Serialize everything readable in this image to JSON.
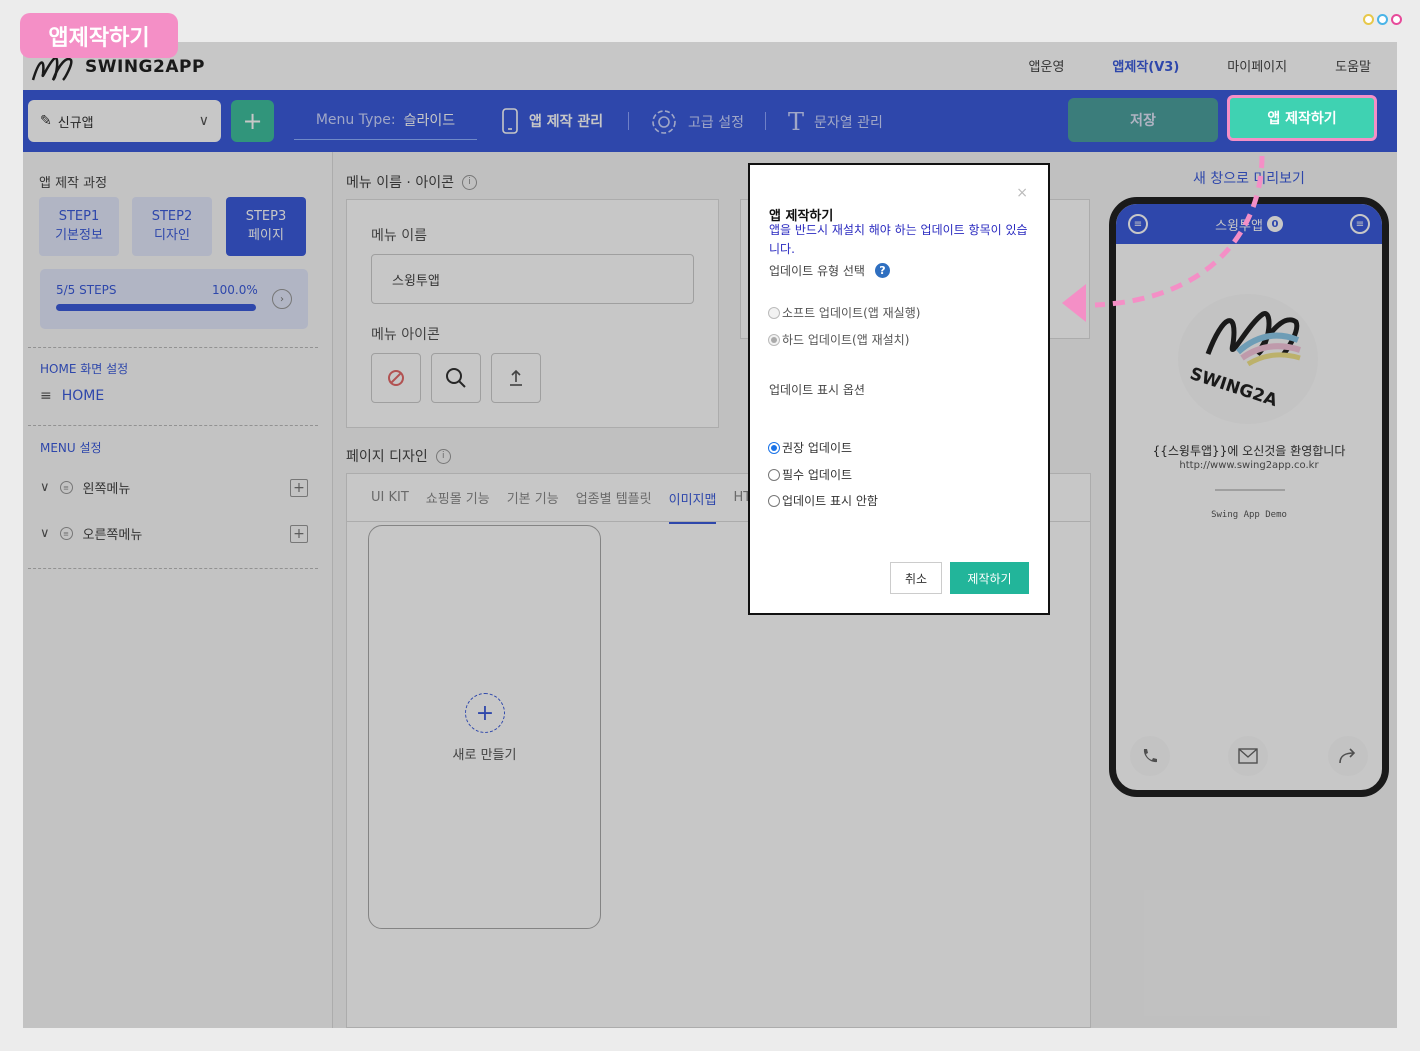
{
  "label_badge": "앱제작하기",
  "header": {
    "logo_text": "SWING2APP",
    "nav": [
      "앱운영",
      "앱제작(V3)",
      "마이페이지",
      "도움말"
    ]
  },
  "toolbar": {
    "app_select": "신규앱",
    "add_label": "+",
    "menu_type_label": "Menu Type:",
    "menu_type_value": "슬라이드",
    "app_manage": "앱 제작 관리",
    "advanced": "고급 설정",
    "strings": "문자열 관리",
    "save": "저장",
    "build": "앱 제작하기"
  },
  "sidebar": {
    "title": "앱 제작 과정",
    "steps": [
      {
        "line1": "STEP1",
        "line2": "기본정보"
      },
      {
        "line1": "STEP2",
        "line2": "디자인"
      },
      {
        "line1": "STEP3",
        "line2": "페이지"
      }
    ],
    "progress_label": "5/5 STEPS",
    "progress_pct": "100.0%",
    "progress_value": 1.0,
    "home_section": "HOME 화면 설정",
    "home_item": "HOME",
    "menu_section": "MENU 설정",
    "menus": [
      "왼쪽메뉴",
      "오른쪽메뉴"
    ]
  },
  "main": {
    "name_icon_title": "메뉴 이름 · 아이콘",
    "name_label": "메뉴 이름",
    "name_value": "스윙투앱",
    "icon_label": "메뉴 아이콘",
    "page_design_title": "페이지 디자인",
    "tabs": [
      "UI KIT",
      "쇼핑몰 기능",
      "기본 기능",
      "업종별 템플릿",
      "이미지맵",
      "HT"
    ],
    "new_label": "새로 만들기"
  },
  "preview": {
    "link": "새 창으로 미리보기",
    "app_name": "스윙투앱",
    "badge": "0",
    "welcome": "{{스윙투앱}}에 오신것을 환영합니다",
    "url": "http://www.swing2app.co.kr",
    "demo": "Swing App Demo",
    "logo_text": "SWING2A"
  },
  "modal": {
    "close": "×",
    "title": "앱 제작하기",
    "warning": "앱을 반드시 재설치 해야 하는 업데이트 항목이 있습니다.",
    "update_type_label": "업데이트 유형 선택",
    "options_type": [
      "소프트 업데이트(앱 재실행)",
      "하드 업데이트(앱 재설치)"
    ],
    "display_label": "업데이트 표시 옵션",
    "options_display": [
      "권장 업데이트",
      "필수 업데이트",
      "업데이트 표시 안함"
    ],
    "cancel": "취소",
    "confirm": "제작하기"
  },
  "colors": {
    "primary": "#3b5bdb",
    "accent": "#3fd2b2",
    "highlight": "#f48fc6"
  }
}
